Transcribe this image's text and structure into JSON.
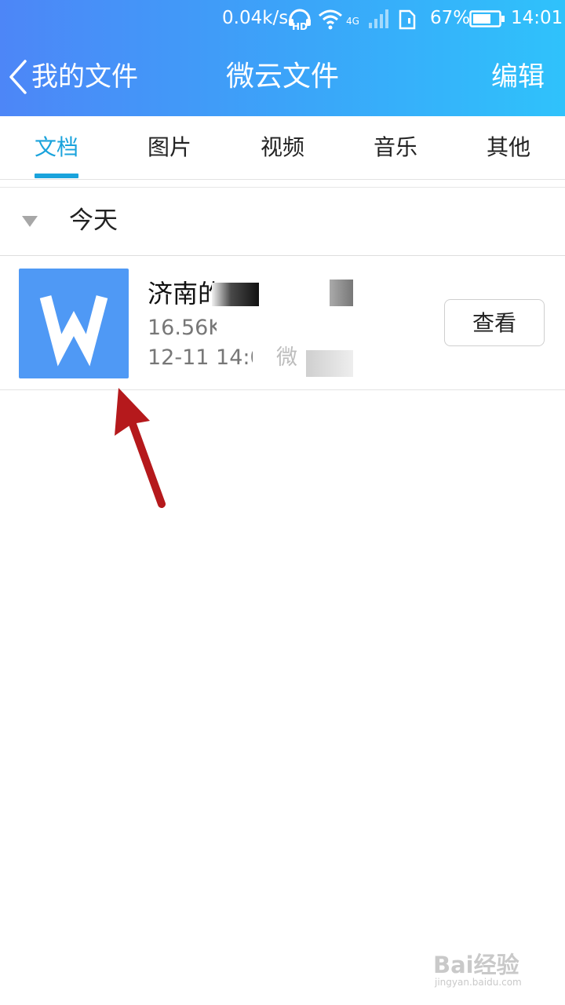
{
  "status_bar": {
    "network_speed": "0.04k/s",
    "hd_badge": "HD",
    "network_type": "4G",
    "battery_percent": "67%",
    "time": "14:01",
    "icons": [
      "headphone-hd-icon",
      "wifi-icon",
      "signal-icon",
      "sim-icon",
      "battery-icon"
    ]
  },
  "nav": {
    "back_label": "我的文件",
    "title": "微云文件",
    "edit_label": "编辑"
  },
  "tabs": [
    {
      "label": "文档",
      "active": true
    },
    {
      "label": "图片",
      "active": false
    },
    {
      "label": "视频",
      "active": false
    },
    {
      "label": "音乐",
      "active": false
    },
    {
      "label": "其他",
      "active": false
    }
  ],
  "group": {
    "label": "今天"
  },
  "files": [
    {
      "name_visible": "济南的",
      "size_visible": "16.56K",
      "date_visible": "12-11 14:0",
      "source_partial": "微",
      "action_label": "查看",
      "icon": "wps-word-doc-icon"
    }
  ],
  "watermark": {
    "main": "Bai经验",
    "sub": "jingyan.baidu.com"
  },
  "colors": {
    "header_gradient_start": "#4d86f7",
    "header_gradient_end": "#2fc2fb",
    "tab_active": "#1aa3dc",
    "doc_icon_bg": "#4f99f5",
    "annotation_arrow": "#b5191c"
  }
}
